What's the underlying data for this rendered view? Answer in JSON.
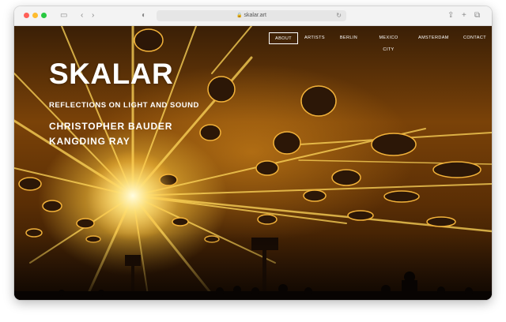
{
  "browser": {
    "url": "skalar.art"
  },
  "nav": {
    "items": [
      {
        "label": "ABOUT"
      },
      {
        "label": "ARTISTS"
      },
      {
        "label": "BERLIN"
      },
      {
        "label": "MEXICO CITY"
      },
      {
        "label": "AMSTERDAM"
      },
      {
        "label": "CONTACT"
      }
    ]
  },
  "hero": {
    "title": "SKALAR",
    "subtitle": "REFLECTIONS ON LIGHT AND SOUND",
    "artists": [
      "CHRISTOPHER BAUDER",
      "KANGDING RAY"
    ]
  },
  "colors": {
    "accent": "#f5b32a",
    "text": "#ffffff"
  }
}
